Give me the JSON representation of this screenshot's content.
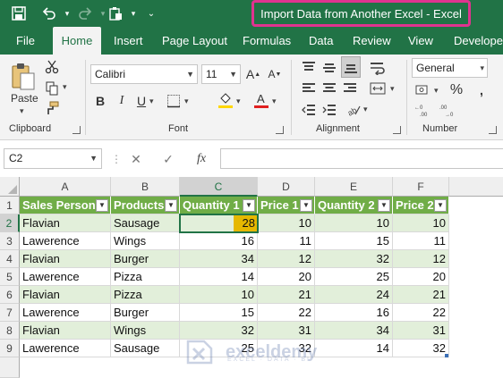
{
  "window": {
    "title": "Import Data from Another Excel  -  Excel",
    "title_accent": "#e0338f",
    "brand_color": "#217346"
  },
  "tabs": [
    {
      "label": "File"
    },
    {
      "label": "Home"
    },
    {
      "label": "Insert"
    },
    {
      "label": "Page Layout"
    },
    {
      "label": "Formulas"
    },
    {
      "label": "Data"
    },
    {
      "label": "Review"
    },
    {
      "label": "View"
    },
    {
      "label": "Developer"
    }
  ],
  "active_tab": "Home",
  "ribbon": {
    "clipboard": {
      "label": "Clipboard",
      "paste_label": "Paste"
    },
    "font": {
      "label": "Font",
      "font_name": "Calibri",
      "font_size": "11"
    },
    "alignment": {
      "label": "Alignment"
    },
    "number": {
      "label": "Number",
      "format": "General"
    }
  },
  "formula_bar": {
    "name_box": "C2",
    "fx_symbol": "fx",
    "formula": ""
  },
  "sheet": {
    "columns": [
      "A",
      "B",
      "C",
      "D",
      "E",
      "F"
    ],
    "selected_column": "C",
    "row_numbers": [
      "1",
      "2",
      "3",
      "4",
      "5",
      "6",
      "7",
      "8",
      "9"
    ],
    "selected_row": "2",
    "headers": [
      "Sales Person",
      "Products",
      "Quantity 1",
      "Price 1",
      "Quantity 2",
      "Price 2"
    ],
    "rows": [
      [
        "Flavian",
        "Sausage",
        "28",
        "10",
        "10",
        "10"
      ],
      [
        "Lawerence",
        "Wings",
        "16",
        "11",
        "15",
        "11"
      ],
      [
        "Flavian",
        "Burger",
        "34",
        "12",
        "32",
        "12"
      ],
      [
        "Lawerence",
        "Pizza",
        "14",
        "20",
        "25",
        "20"
      ],
      [
        "Flavian",
        "Pizza",
        "10",
        "21",
        "24",
        "21"
      ],
      [
        "Lawerence",
        "Burger",
        "15",
        "22",
        "16",
        "22"
      ],
      [
        "Flavian",
        "Wings",
        "32",
        "31",
        "34",
        "31"
      ],
      [
        "Lawerence",
        "Sausage",
        "25",
        "32",
        "14",
        "32"
      ]
    ],
    "header_color": "#70ad47",
    "band_color": "#e2efda",
    "highlight_color": "#e6b800"
  },
  "watermark": {
    "name": "exceldemy",
    "tagline": "EXCEL · DATA · BI"
  }
}
